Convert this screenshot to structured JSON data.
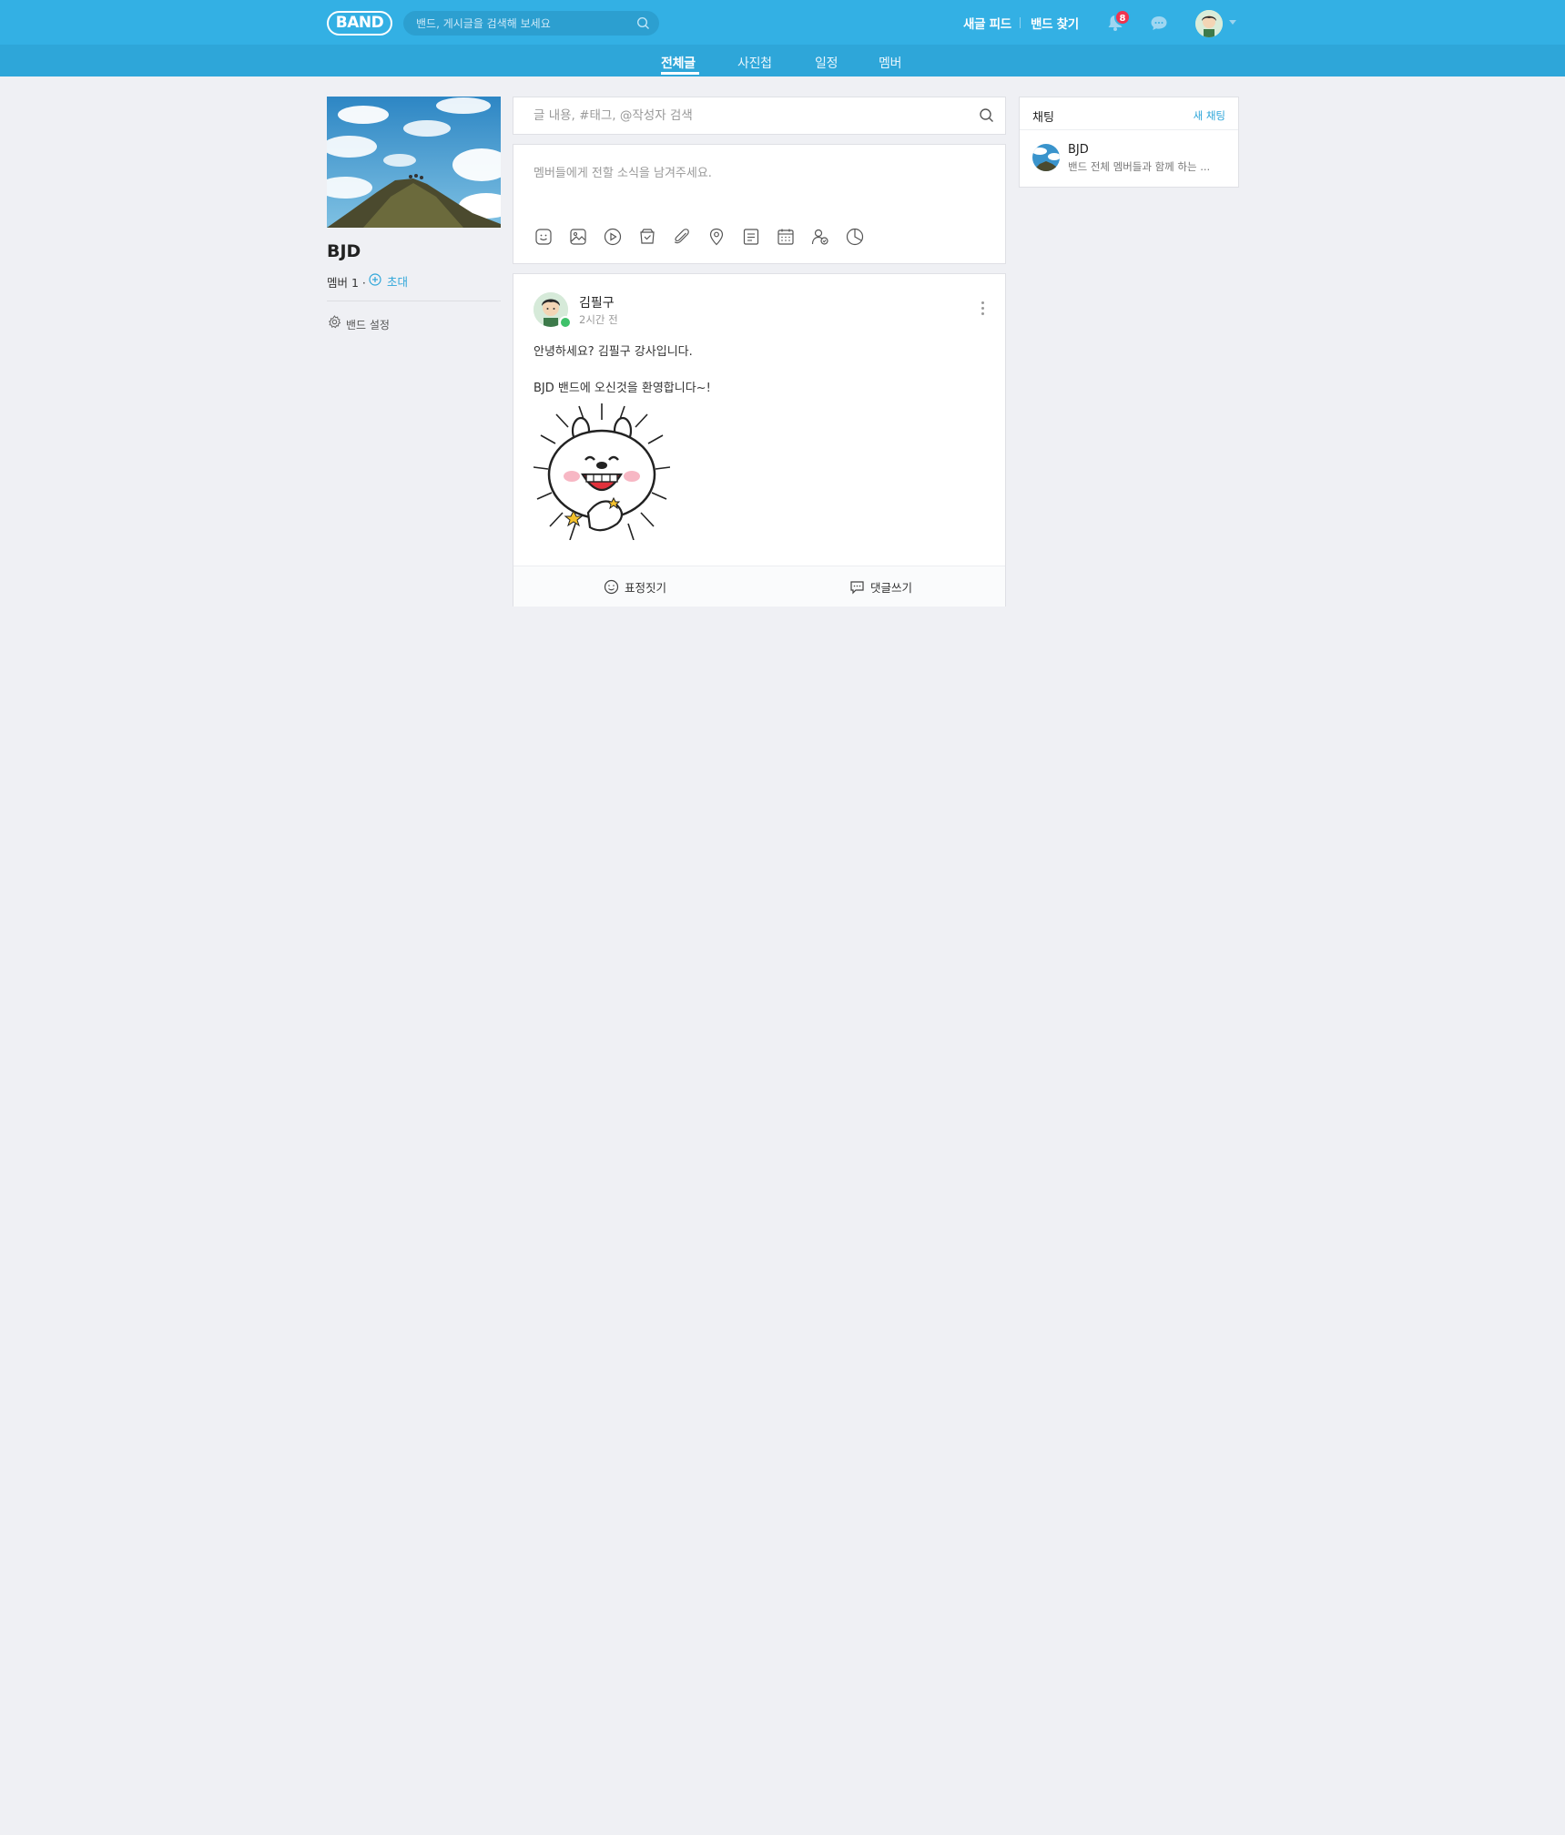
{
  "header": {
    "logo": "BAND",
    "search_placeholder": "밴드, 게시글을 검색해 보세요",
    "links": [
      "새글 피드",
      "밴드 찾기"
    ],
    "notification_count": "8"
  },
  "tabs": [
    {
      "label": "전체글",
      "active": true
    },
    {
      "label": "사진첩",
      "active": false
    },
    {
      "label": "일정",
      "active": false
    },
    {
      "label": "멤버",
      "active": false
    }
  ],
  "band": {
    "name": "BJD",
    "members": "멤버 1 ·",
    "invite": "초대",
    "settings": "밴드 설정"
  },
  "post_search": {
    "placeholder": "글 내용, #태그, @작성자 검색"
  },
  "composer": {
    "placeholder": "멤버들에게 전할 소식을 남겨주세요.",
    "tools": [
      "sticker-icon",
      "photo-icon",
      "video-icon",
      "vote-box-icon",
      "attach-icon",
      "location-icon",
      "todo-icon",
      "calendar-icon",
      "member-tag-icon",
      "quiz-icon"
    ]
  },
  "post": {
    "author": "김필구",
    "time": "2시간 전",
    "line1": "안녕하세요? 김필구 강사입니다.",
    "line2": "BJD 밴드에 오신것을 환영합니다~!",
    "actions": {
      "emotion": "표정짓기",
      "comment": "댓글쓰기"
    }
  },
  "chat": {
    "title": "채팅",
    "new": "새 채팅",
    "rooms": [
      {
        "name": "BJD",
        "message": "밴드 전체 멤버들과 함께 하는 ..."
      }
    ]
  },
  "colors": {
    "brand": "#33b0e4",
    "subnav": "#2ea6d9",
    "badge": "#f0344e",
    "background": "#eff0f4"
  }
}
